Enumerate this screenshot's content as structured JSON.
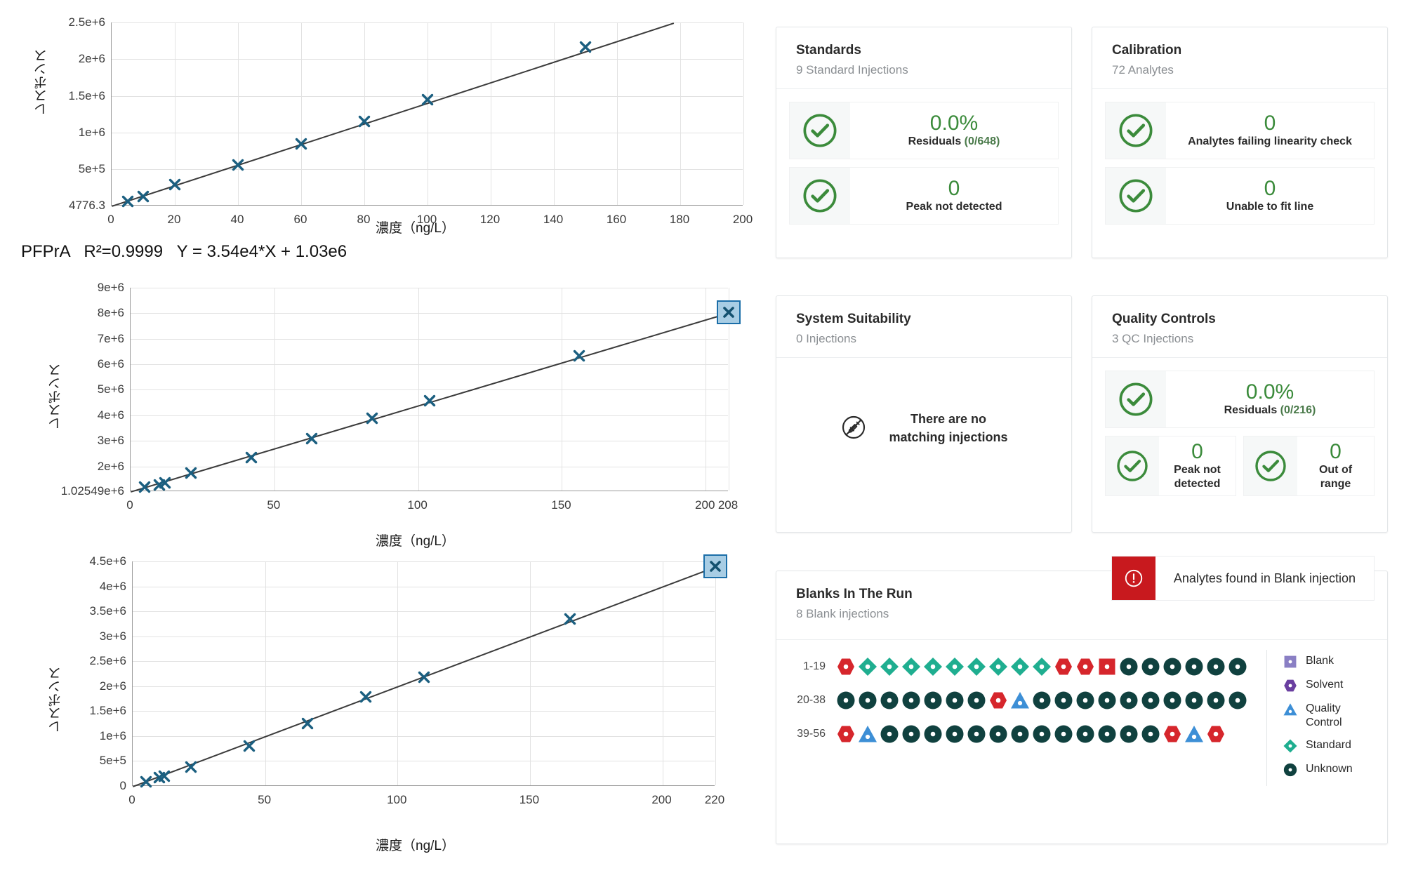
{
  "chart_data": [
    {
      "type": "scatter",
      "title": "",
      "xlabel": "濃度（ng/L）",
      "ylabel": "レスポンス",
      "xlim": [
        0,
        200
      ],
      "ylim": [
        4776.3,
        2500000
      ],
      "xticks": [
        "0",
        "20",
        "40",
        "60",
        "80",
        "100",
        "120",
        "140",
        "160",
        "180",
        "200"
      ],
      "yticks": [
        "4776.3",
        "5e+5",
        "1e+6",
        "1.5e+6",
        "2e+6",
        "2.5e+6"
      ],
      "grid": true,
      "legend": "none",
      "series": [
        {
          "name": "calibration points",
          "marker": "x",
          "x": [
            5,
            10,
            20,
            40,
            60,
            80,
            100,
            150
          ],
          "y": [
            60000,
            130000,
            290000,
            560000,
            850000,
            1150000,
            1450000,
            2170000
          ]
        }
      ],
      "fit_line": {
        "from_x": 0,
        "from_y": 4776.3,
        "to_x": 178,
        "to_y": 2500000
      }
    },
    {
      "type": "scatter",
      "title": "",
      "xlabel": "濃度（ng/L）",
      "ylabel": "レスポンス",
      "xlim": [
        0,
        208
      ],
      "ylim": [
        1025490,
        9000000
      ],
      "xticks": [
        "0",
        "50",
        "100",
        "150",
        "200",
        "208"
      ],
      "yticks": [
        "1.02549e+6",
        "2e+6",
        "3e+6",
        "4e+6",
        "5e+6",
        "6e+6",
        "7e+6",
        "8e+6",
        "9e+6"
      ],
      "grid": true,
      "legend": "none",
      "series": [
        {
          "name": "calibration points",
          "marker": "x",
          "x": [
            5,
            10,
            12,
            21,
            42,
            63,
            84,
            104,
            156,
            208
          ],
          "y": [
            1180000,
            1280000,
            1350000,
            1750000,
            2350000,
            3080000,
            3880000,
            4570000,
            6330000,
            8030000
          ]
        }
      ],
      "fit_line": {
        "from_x": 0,
        "from_y": 1025490,
        "to_x": 208,
        "to_y": 8030000
      },
      "selected_point": {
        "x": 208,
        "y": 8030000
      }
    },
    {
      "type": "scatter",
      "title": "",
      "xlabel": "濃度（ng/L）",
      "ylabel": "レスポンス",
      "xlim": [
        0,
        220
      ],
      "ylim": [
        0,
        4500000
      ],
      "xticks": [
        "0",
        "50",
        "100",
        "150",
        "200",
        "220"
      ],
      "yticks": [
        "0",
        "5e+5",
        "1e+6",
        "1.5e+6",
        "2e+6",
        "2.5e+6",
        "3e+6",
        "3.5e+6",
        "4e+6",
        "4.5e+6"
      ],
      "grid": true,
      "legend": "none",
      "series": [
        {
          "name": "calibration points",
          "marker": "x",
          "x": [
            5,
            10,
            12,
            22,
            44,
            66,
            88,
            110,
            165,
            220
          ],
          "y": [
            90000,
            170000,
            200000,
            380000,
            800000,
            1250000,
            1790000,
            2180000,
            3340000,
            4400000
          ]
        }
      ],
      "fit_line": {
        "from_x": 0,
        "from_y": 0,
        "to_x": 220,
        "to_y": 4400000
      },
      "selected_point": {
        "x": 220,
        "y": 4400000
      }
    }
  ],
  "equation": {
    "analyte": "PFPrA",
    "r_squared": "R²=0.9999",
    "formula": "Y = 3.54e4*X + 1.03e6",
    "full": "PFPrA   R²=0.9999   Y = 3.54e4*X + 1.03e6"
  },
  "dashboard": {
    "standards": {
      "title": "Standards",
      "subtitle": "9 Standard Injections",
      "metrics": [
        {
          "icon": "check-circle-icon",
          "value": "0.0%",
          "label": "Residuals ",
          "sublabel": "(0/648)"
        },
        {
          "icon": "check-circle-icon",
          "value": "0",
          "label": "Peak not detected",
          "sublabel": ""
        }
      ]
    },
    "calibration": {
      "title": "Calibration",
      "subtitle": "72 Analytes",
      "metrics": [
        {
          "icon": "check-circle-icon",
          "value": "0",
          "label": "Analytes failing linearity check",
          "sublabel": ""
        },
        {
          "icon": "check-circle-icon",
          "value": "0",
          "label": "Unable to fit line",
          "sublabel": ""
        }
      ]
    },
    "system_suitability": {
      "title": "System Suitability",
      "subtitle": "0 Injections",
      "empty_icon": "no-injection-icon",
      "empty_text_line1": "There are no",
      "empty_text_line2": "matching injections"
    },
    "quality_controls": {
      "title": "Quality Controls",
      "subtitle": "3 QC Injections",
      "metrics": [
        {
          "icon": "check-circle-icon",
          "value": "0.0%",
          "label": "Residuals ",
          "sublabel": "(0/216)"
        },
        {
          "icon": "check-circle-icon",
          "value": "0",
          "label": "Peak not detected",
          "sublabel": ""
        },
        {
          "icon": "check-circle-icon",
          "value": "0",
          "label": "Out of range",
          "sublabel": ""
        }
      ]
    },
    "blanks": {
      "title": "Blanks In The Run",
      "subtitle": "8 Blank injections",
      "alert": {
        "icon": "alert-exclamation-icon",
        "message": "Analytes found in Blank injection",
        "color": "#c8191e"
      },
      "rows": [
        {
          "label": "1-19",
          "items": [
            "solvent",
            "standard",
            "standard",
            "standard",
            "standard",
            "standard",
            "standard",
            "standard",
            "standard",
            "standard",
            "solvent",
            "solvent",
            "blank",
            "unknown",
            "unknown",
            "unknown",
            "unknown",
            "unknown",
            "unknown"
          ]
        },
        {
          "label": "20-38",
          "items": [
            "unknown",
            "unknown",
            "unknown",
            "unknown",
            "unknown",
            "unknown",
            "unknown",
            "solvent",
            "quality-control",
            "unknown",
            "unknown",
            "unknown",
            "unknown",
            "unknown",
            "unknown",
            "unknown",
            "unknown",
            "unknown",
            "unknown"
          ]
        },
        {
          "label": "39-56",
          "items": [
            "solvent",
            "quality-control",
            "unknown",
            "unknown",
            "unknown",
            "unknown",
            "unknown",
            "unknown",
            "unknown",
            "unknown",
            "unknown",
            "unknown",
            "unknown",
            "unknown",
            "unknown",
            "solvent",
            "quality-control",
            "solvent"
          ]
        }
      ],
      "legend": [
        {
          "shape": "square",
          "label": "Blank",
          "color": "#8a7fc4"
        },
        {
          "shape": "hexagon",
          "label": "Solvent",
          "color": "#6a3fa0"
        },
        {
          "shape": "triangle",
          "label": "Quality Control",
          "color": "#3d8fd6"
        },
        {
          "shape": "diamond",
          "label": "Standard",
          "color": "#1fae90"
        },
        {
          "shape": "circle",
          "label": "Unknown",
          "color": "#10413f"
        }
      ],
      "shape_colors_in_rows": {
        "solvent": "#d6262c",
        "blank": "#d6262c",
        "standard": "#1fae90",
        "quality-control": "#3d8fd6",
        "unknown": "#10413f"
      }
    }
  },
  "colors": {
    "marker": "#1b5f80",
    "line": "#3b3b3b",
    "ok_green": "#3b8b3b",
    "alert_red": "#c8191e",
    "selection_fill": "#a8cde4",
    "selection_border": "#1b6ea8"
  }
}
